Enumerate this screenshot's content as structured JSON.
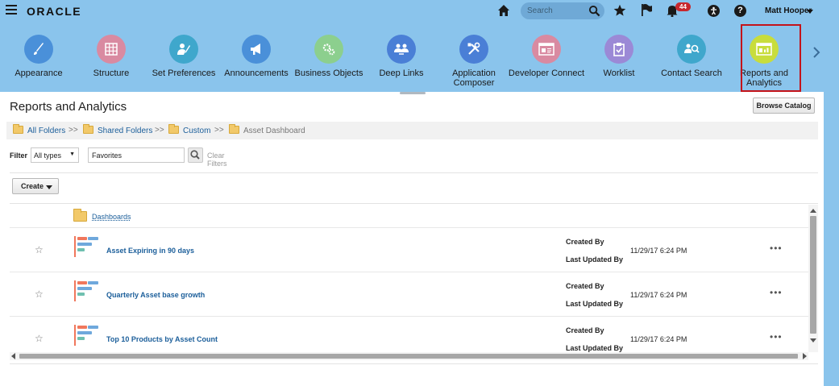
{
  "topbar": {
    "logo": "ORACLE",
    "search_placeholder": "Search",
    "notification_count": "44",
    "help_glyph": "?",
    "user_name": "Matt Hooper"
  },
  "springboard": {
    "items": [
      {
        "label": "Appearance",
        "color": "#4a90d9",
        "icon": "brush-icon"
      },
      {
        "label": "Structure",
        "color": "#d98aa1",
        "icon": "grid-icon"
      },
      {
        "label": "Set Preferences",
        "color": "#3fa7cc",
        "icon": "user-settings-icon"
      },
      {
        "label": "Announcements",
        "color": "#4a90d9",
        "icon": "megaphone-icon"
      },
      {
        "label": "Business Objects",
        "color": "#8ccf8e",
        "icon": "gears-icon"
      },
      {
        "label": "Deep Links",
        "color": "#4a7fd6",
        "icon": "people-link-icon"
      },
      {
        "label": "Application Composer",
        "color": "#4a7fd6",
        "icon": "tools-icon"
      },
      {
        "label": "Developer Connect",
        "color": "#d98aa1",
        "icon": "browser-icon"
      },
      {
        "label": "Worklist",
        "color": "#9b89d6",
        "icon": "clipboard-check-icon"
      },
      {
        "label": "Contact Search",
        "color": "#3fa7cc",
        "icon": "people-search-icon"
      },
      {
        "label": "Reports and Analytics",
        "color": "#c8dd3c",
        "icon": "report-icon"
      }
    ]
  },
  "page": {
    "title": "Reports and Analytics",
    "browse_catalog": "Browse Catalog"
  },
  "breadcrumb": {
    "items": [
      "All Folders",
      "Shared Folders",
      "Custom",
      "Asset Dashboard"
    ],
    "separator": ">>"
  },
  "filter": {
    "label": "Filter",
    "type_value": "All types",
    "input_value": "Favorites",
    "clear": "Clear Filters"
  },
  "create_label": "Create",
  "list": {
    "folder": "Dashboards",
    "rows": [
      {
        "name": "Asset Expiring in 90 days",
        "created_by": "Created By",
        "updated_by": "Last Updated By",
        "date": "11/29/17 6:24 PM",
        "more": "•••"
      },
      {
        "name": "Quarterly Asset base growth",
        "created_by": "Created By",
        "updated_by": "Last Updated By",
        "date": "11/29/17 6:24 PM",
        "more": "•••"
      },
      {
        "name": "Top 10 Products by Asset Count",
        "created_by": "Created By",
        "updated_by": "Last Updated By",
        "date": "11/29/17 6:24 PM",
        "more": "•••"
      }
    ]
  },
  "colors": {
    "header_bg": "#8ac4ec",
    "link": "#1b5e9a",
    "selected_border": "#c4131a"
  }
}
